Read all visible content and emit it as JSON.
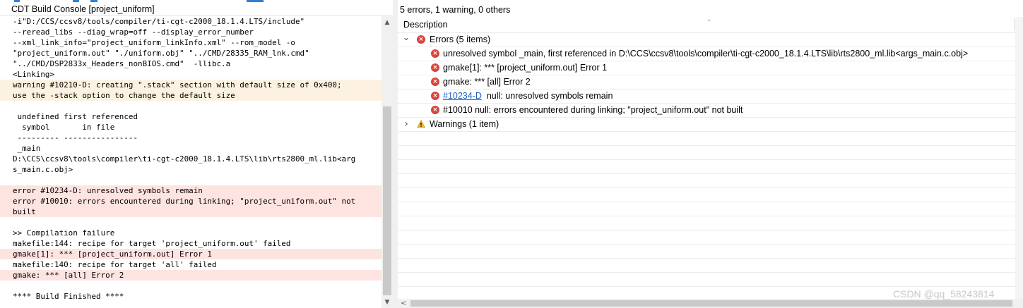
{
  "console": {
    "title": "CDT Build Console [project_uniform]",
    "lines": [
      {
        "text": "-i\"D:/CCS/ccsv8/tools/compiler/ti-cgt-c2000_18.1.4.LTS/include\"",
        "kind": "normal"
      },
      {
        "text": "--reread_libs --diag_wrap=off --display_error_number",
        "kind": "normal"
      },
      {
        "text": "--xml_link_info=\"project_uniform_linkInfo.xml\" --rom_model -o",
        "kind": "normal"
      },
      {
        "text": "\"project_uniform.out\" \"./uniform.obj\" \"../CMD/28335_RAM_lnk.cmd\"",
        "kind": "normal"
      },
      {
        "text": "\"../CMD/DSP2833x_Headers_nonBIOS.cmd\"  -llibc.a",
        "kind": "normal"
      },
      {
        "text": "<Linking>",
        "kind": "normal"
      },
      {
        "text": "warning #10210-D: creating \".stack\" section with default size of 0x400;",
        "kind": "warn"
      },
      {
        "text": "use the -stack option to change the default size",
        "kind": "warn"
      },
      {
        "text": "",
        "kind": "normal"
      },
      {
        "text": " undefined first referenced",
        "kind": "normal"
      },
      {
        "text": "  symbol       in file",
        "kind": "normal"
      },
      {
        "text": " --------- ----------------",
        "kind": "normal"
      },
      {
        "text": " _main",
        "kind": "normal"
      },
      {
        "text": "D:\\CCS\\ccsv8\\tools\\compiler\\ti-cgt-c2000_18.1.4.LTS\\lib\\rts2800_ml.lib<arg",
        "kind": "normal"
      },
      {
        "text": "s_main.c.obj>",
        "kind": "normal"
      },
      {
        "text": "",
        "kind": "normal"
      },
      {
        "text": "error #10234-D: unresolved symbols remain",
        "kind": "err"
      },
      {
        "text": "error #10010: errors encountered during linking; \"project_uniform.out\" not",
        "kind": "err"
      },
      {
        "text": "built",
        "kind": "err"
      },
      {
        "text": "",
        "kind": "normal"
      },
      {
        "text": ">> Compilation failure",
        "kind": "normal"
      },
      {
        "text": "makefile:144: recipe for target 'project_uniform.out' failed",
        "kind": "normal"
      },
      {
        "text": "gmake[1]: *** [project_uniform.out] Error 1",
        "kind": "err"
      },
      {
        "text": "makefile:140: recipe for target 'all' failed",
        "kind": "normal"
      },
      {
        "text": "gmake: *** [all] Error 2",
        "kind": "err"
      },
      {
        "text": "",
        "kind": "normal"
      },
      {
        "text": "**** Build Finished ****",
        "kind": "normal"
      }
    ]
  },
  "problems": {
    "summary": "5 errors, 1 warning, 0 others",
    "column_description": "Description",
    "errors_group": {
      "label": "Errors (5 items)",
      "expanded": true
    },
    "errors": [
      {
        "text": "unresolved symbol _main, first referenced in D:\\CCS\\ccsv8\\tools\\compiler\\ti-cgt-c2000_18.1.4.LTS\\lib\\rts2800_ml.lib<args_main.c.obj>",
        "link": ""
      },
      {
        "text": "gmake[1]: *** [project_uniform.out] Error 1",
        "link": ""
      },
      {
        "text": "gmake: *** [all] Error 2",
        "link": ""
      },
      {
        "text": "  null: unresolved symbols remain",
        "link": "#10234-D"
      },
      {
        "text": "#10010 null: errors encountered during linking; \"project_uniform.out\" not built",
        "link": ""
      }
    ],
    "warnings_group": {
      "label": "Warnings (1 item)",
      "expanded": false
    }
  },
  "icons": {
    "error": "error-icon",
    "warning": "warning-icon",
    "expanded": "chevron-down-icon",
    "collapsed": "chevron-right-icon"
  },
  "colors": {
    "error_red": "#d8443c",
    "warning_yellow": "#f2c02e",
    "warn_line_bg": "#fdf2e2",
    "err_line_bg": "#fde4e1",
    "link_blue": "#1a62c9"
  },
  "watermark": "CSDN @qq_58243814"
}
